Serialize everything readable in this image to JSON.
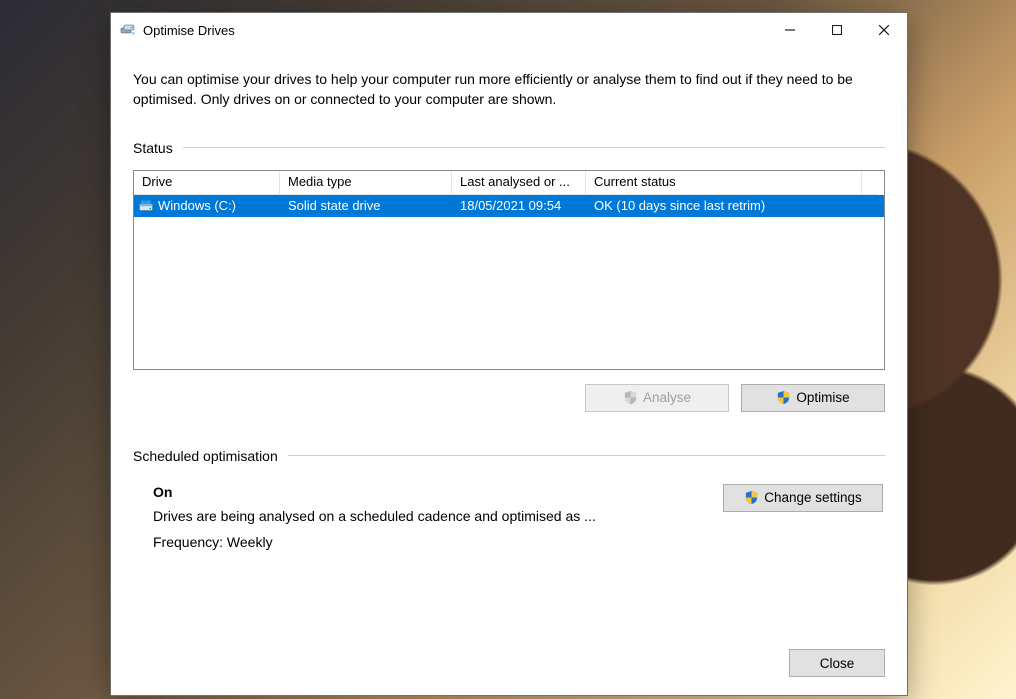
{
  "window": {
    "title": "Optimise Drives"
  },
  "intro": "You can optimise your drives to help your computer run more efficiently or analyse them to find out if they need to be optimised. Only drives on or connected to your computer are shown.",
  "status_section": {
    "label": "Status",
    "columns": {
      "drive": "Drive",
      "media": "Media type",
      "last": "Last analysed or ...",
      "status": "Current status"
    },
    "rows": [
      {
        "drive": "Windows (C:)",
        "media": "Solid state drive",
        "last": "18/05/2021 09:54",
        "status": "OK (10 days since last retrim)"
      }
    ]
  },
  "buttons": {
    "analyse": "Analyse",
    "optimise": "Optimise",
    "change": "Change settings",
    "close": "Close"
  },
  "scheduled": {
    "label": "Scheduled optimisation",
    "on": "On",
    "desc": "Drives are being analysed on a scheduled cadence and optimised as ...",
    "freq": "Frequency: Weekly"
  }
}
